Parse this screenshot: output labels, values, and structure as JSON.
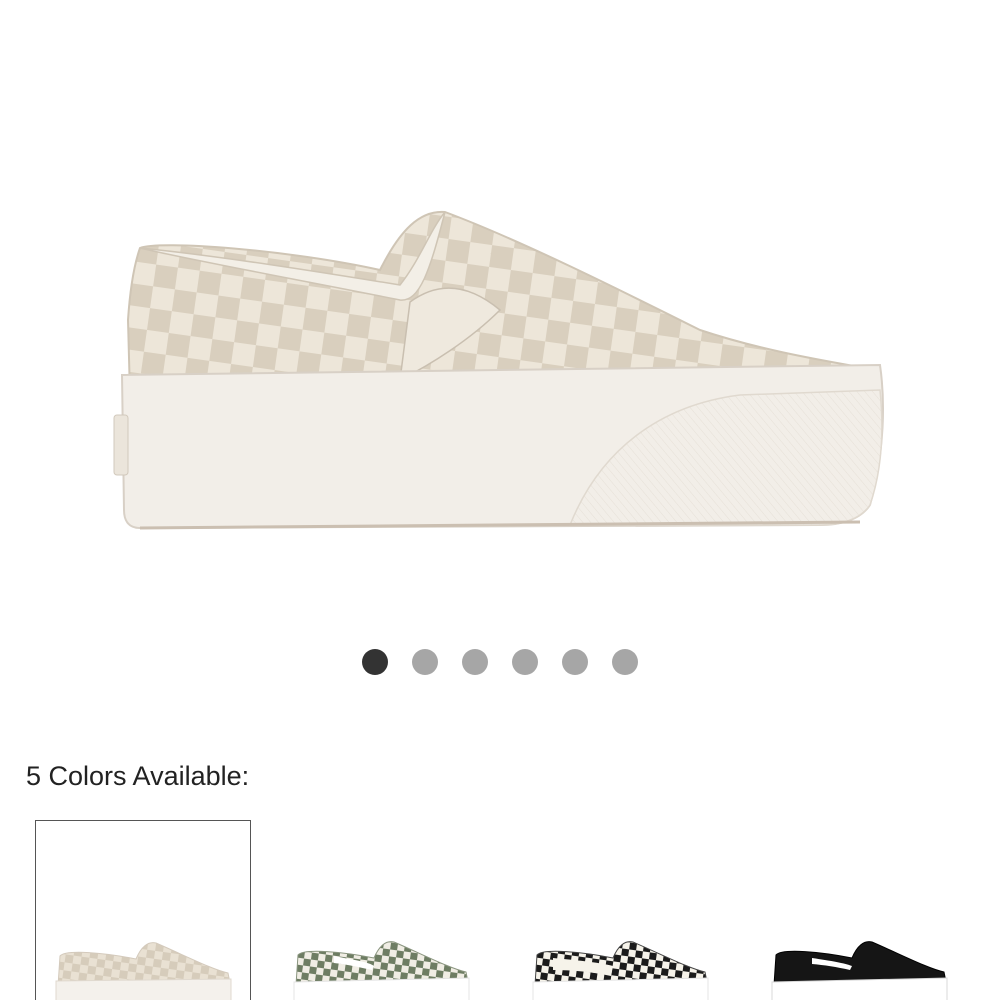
{
  "product_gallery": {
    "main_image": {
      "icon": "slip-on-platform-shoe-image",
      "colors": {
        "canvas": "#ede6d9",
        "checker_dark": "#d9cfbe",
        "sole": "#f2eee8",
        "sole_shadow": "#d8d0c6",
        "outline": "#c9bfb0"
      }
    },
    "pagination": {
      "count": 6,
      "active_index": 0,
      "active_color": "#333333",
      "inactive_color": "#a6a6a6"
    }
  },
  "colors_section": {
    "label": "5 Colors Available:",
    "selected_index": 0,
    "swatches": [
      {
        "icon": "cream-checkerboard-shoe-thumbnail",
        "upper": "#e9e1d3",
        "checker": "#d6ccbb",
        "sole": "#f4f1ec"
      },
      {
        "icon": "green-checkerboard-shoe-thumbnail",
        "upper": "#f0ede4",
        "checker": "#6e7d63",
        "sole": "#ffffff"
      },
      {
        "icon": "black-white-checkerboard-shoe-thumbnail",
        "upper": "#f6f3ea",
        "checker": "#1b1b1b",
        "sole": "#ffffff"
      },
      {
        "icon": "black-shoe-thumbnail",
        "upper": "#151515",
        "checker": "#151515",
        "sole": "#ffffff"
      }
    ]
  }
}
